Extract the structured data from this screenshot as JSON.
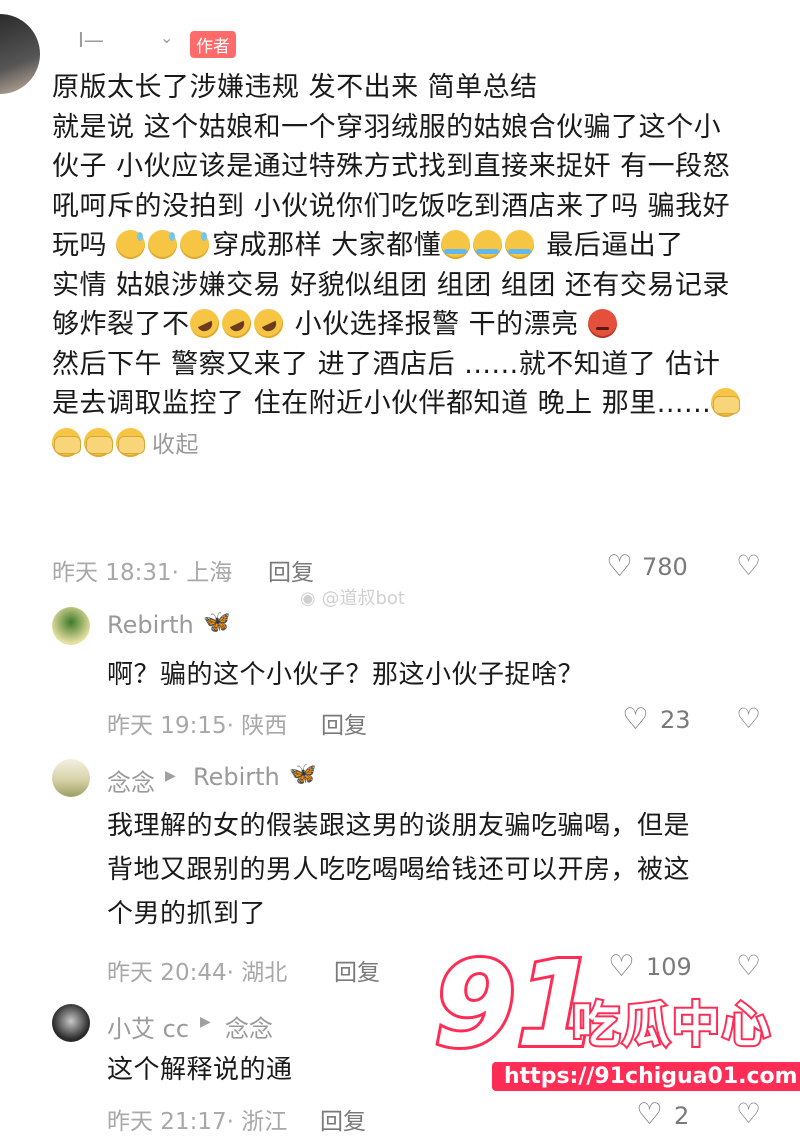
{
  "comment": {
    "username": "I—",
    "badge": "作者",
    "lines": [
      "原版太长了涉嫌违规 发不出来 简单总结",
      "就是说 这个姑娘和一个穿羽绒服的姑娘合伙骗了这个小",
      "伙子 小伙应该是通过特殊方式找到直接来捉奸 有一段怒",
      "吼呵斥的没拍到  小伙说你们吃饭吃到酒店来了吗 骗我好"
    ],
    "line5a": "玩吗 ",
    "line5b": "穿成那样 大家都懂",
    "line5c": "  最后逼出了",
    "line6": "实情 姑娘涉嫌交易 好貌似组团  组团 组团 还有交易记录",
    "line7a": "够炸裂了不",
    "line7b": " 小伙选择报警 干的漂亮 ",
    "line8": "然后下午 警察又来了 进了酒店后 ......就不知道了  估计",
    "line9": "是去调取监控了 住在附近小伙伴都知道 晚上 那里......",
    "fold": "收起",
    "time": "昨天 18:31· 上海",
    "reply": "回复",
    "likes": "780"
  },
  "watermark_weibo": "@道叔bot",
  "replies": [
    {
      "name": "Rebirth",
      "text_lines": [
        "啊？骗的这个小伙子？那这小伙子捉啥？"
      ],
      "time": "昨天 19:15· 陕西",
      "reply": "回复",
      "likes": "23"
    },
    {
      "name": "念念",
      "to": "Rebirth",
      "text_lines": [
        "我理解的女的假装跟这男的谈朋友骗吃骗喝，但是",
        "背地又跟别的男人吃吃喝喝给钱还可以开房，被这",
        "个男的抓到了"
      ],
      "time": "昨天 20:44· 湖北",
      "reply": "回复",
      "likes": "109"
    },
    {
      "name": "小艾 cc",
      "to": "念念",
      "text_lines": [
        "这个解释说的通"
      ],
      "time": "昨天 21:17· 浙江",
      "reply": "回复",
      "likes": "2"
    }
  ],
  "logo": {
    "number": "91",
    "text": "吃瓜中心",
    "url": "https://91chigua01.com"
  },
  "colors": {
    "accent": "#ff2d55",
    "badge": "#ff6a6a",
    "meta": "#a8a8a8"
  }
}
